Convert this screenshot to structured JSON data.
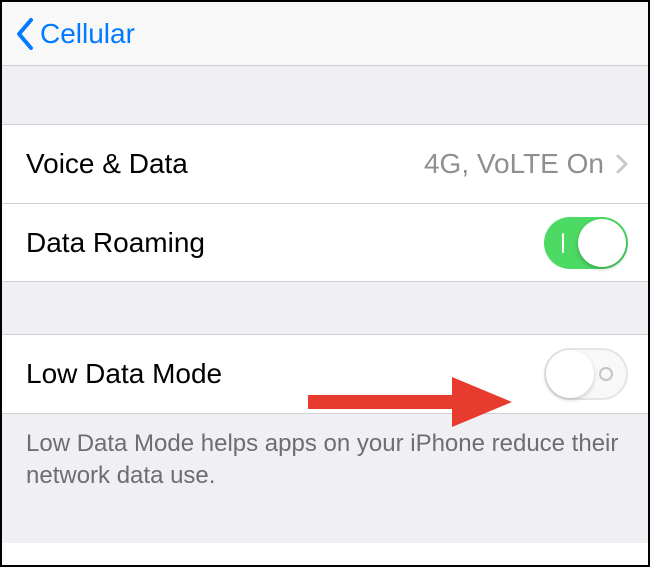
{
  "header": {
    "back_label": "Cellular"
  },
  "rows": {
    "voice_data": {
      "label": "Voice & Data",
      "value": "4G, VoLTE On"
    },
    "data_roaming": {
      "label": "Data Roaming",
      "toggle_on": true
    },
    "low_data_mode": {
      "label": "Low Data Mode",
      "toggle_on": false
    }
  },
  "footer": {
    "text": "Low Data Mode helps apps on your iPhone reduce their network data use."
  },
  "colors": {
    "accent": "#007aff",
    "toggle_on": "#4cd964",
    "annotation": "#e63b2e"
  }
}
